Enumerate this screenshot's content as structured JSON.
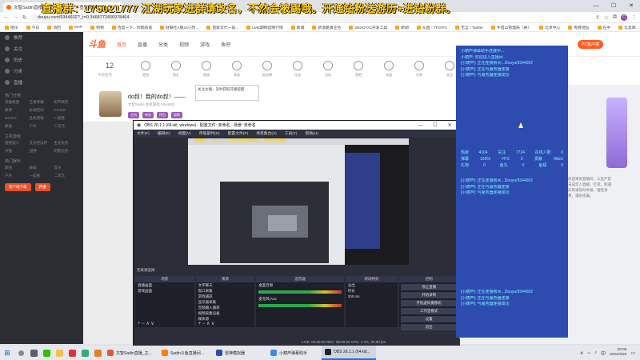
{
  "browser": {
    "tab_title": "文智Sadin直播_主机游戏直播 - 斗鱼直播",
    "url": "douyu.com/9344602?_r=0.3468772456978464",
    "bookmarks": [
      "哈乐",
      "今日",
      "消回",
      "MAP",
      "购物",
      "百度一下，你就知道",
      "财联社A股24小时...",
      "首家云代一站...",
      "LME期铜官网行情",
      "新闻",
      "新浪路演业务",
      "3DDOTA2开发工具",
      "新闻",
      "从盘 - TFGIPC",
      "无言 / Twitter",
      "牛首山管理局（县）",
      "北京中心",
      "免费地址",
      "在中",
      "信息库..."
    ],
    "controls": {
      "minimize": "—",
      "maximize": "☐",
      "close": "✕"
    },
    "profile_initial": "C"
  },
  "banner": "直播群：175021777 江湖玩家进群请改名，不然会被踢哦。开通钻粉送游历+进钻粉群。",
  "sidebar": {
    "items": [
      "推荐",
      "关注",
      "历史",
      "分类",
      "直播"
    ],
    "section1": "热门分类",
    "grid1": [
      "英雄联盟",
      "王者荣耀",
      "和平精英",
      "原神",
      "永劫无间",
      "CS:GO",
      "DOTA2",
      "主机游戏",
      "一起看",
      "颜值",
      "户外",
      "二次元"
    ],
    "section2": "主机游戏",
    "grid2": [
      "怪物猎人",
      "艾尔登法环",
      "生化危机",
      "只狼",
      "战神",
      "刺客信条"
    ],
    "section3": "热门娱乐",
    "grid3": [
      "颜值",
      "舞蹈",
      "音乐",
      "户外",
      "一起看",
      "二次元"
    ],
    "buttons": [
      "客户端下载",
      "开播"
    ]
  },
  "nav": {
    "logo": "斗鱼",
    "items": [
      "首页",
      "直播",
      "分类",
      "视频",
      "游戏",
      "鱼吧"
    ],
    "pc": "PC客户端"
  },
  "category_row": {
    "count": "12",
    "count_label": "今日任务",
    "icons": [
      "签到",
      "鱼丸",
      "鱼翅",
      "贵族",
      "粉丝牌",
      "任务",
      "活动",
      "鱼吧",
      "充值",
      "分享",
      "关注",
      "上一页",
      "一键领取",
      "更多"
    ]
  },
  "room": {
    "title": "do叔！我的do叔！——",
    "meta": "文智Sadin  主机游戏  9344602",
    "tags": [
      "主机",
      "单机",
      "怀旧",
      "剧情"
    ],
    "popup": "关注主播，及时获取开播提醒"
  },
  "right_text": "欢迎来到直播间，斗鱼严禁未成年人直播、打赏。如遇异常请及时举报。理性消费，谨防诈骗。",
  "obs": {
    "title": "OBS 26.1.1 (64-bit, windows) - 配置文件: 未命名 - 场景: 未命名",
    "menu": [
      "文件(F)",
      "编辑(E)",
      "视图(V)",
      "停靠部件(D)",
      "配置文件(P)",
      "场景集合(S)",
      "工具(T)",
      "帮助(H)"
    ],
    "preview_banner": "直播群：175021777 江湖玩家进群请改名，不然会被踢哦",
    "toolbar": "无来源选择",
    "panels": {
      "scenes": {
        "title": "场景",
        "items": [
          "直播画面",
          "游戏画面"
        ]
      },
      "sources": {
        "title": "来源",
        "items": [
          "文字聊天",
          "窗口采集",
          "游戏捕获",
          "显示器采集",
          "音频输入捕获",
          "视频采集设备",
          "媒体源"
        ]
      },
      "mixer": {
        "title": "混音器",
        "items": [
          "桌面音频",
          "麦克风/Aux"
        ]
      },
      "transitions": {
        "title": "转场特效",
        "type": "淡出",
        "duration_label": "时长",
        "duration": "300 ms"
      },
      "controls": {
        "title": "控制",
        "buttons": [
          "停止直播",
          "开始录制",
          "开始虚拟摄像机",
          "工作室模式",
          "设置",
          "退出"
        ]
      }
    },
    "status": "LIVE: 00:00:00   REC: 00:00:00   CPU: 1.4%, 30.00 fps",
    "add_buttons": "+ − ∧ ∨"
  },
  "chat": {
    "lines_top": [
      "小葫芦弹幕助手连接中...",
      "小葫芦: 欢迎进入直播间",
      "[小葫芦]: 正在连接房间...Douyu/9344602",
      "[小葫芦]: 正在与服务器连接",
      "[小葫芦]: 与服务器连接成功"
    ],
    "stats": [
      [
        "热度",
        "4164",
        "关注",
        "7724",
        "在线人数",
        "0"
      ],
      [
        "弹幕",
        "180%",
        "FPS",
        "0",
        "贡献",
        "0kb/s"
      ],
      [
        "礼物",
        "0",
        "鱼丸",
        "0",
        "鱼翅",
        "0"
      ]
    ],
    "lines_mid": [
      "[小葫芦]: 正在连接房间...Douyu/9344602",
      "[小葫芦]: 正在与服务器连接",
      "[小葫芦]: 与服务器连接成功"
    ],
    "lines_bot": [
      "[小葫芦]: 正在连接房间...Douyu/9344602",
      "[小葫芦]: 正在与服务器连接",
      "[小葫芦]: 与服务器连接成功"
    ]
  },
  "taskbar": {
    "start": "⊞",
    "apps": [
      "文智Sadin直播_主...",
      "Sadin斗鱼直播间...",
      "雷神模拟器",
      "小葫芦弹幕助手",
      "OBS 26.1.1 (64-bit..."
    ],
    "clock_time": "20:00",
    "clock_date": "2022/3/20",
    "lang": "中"
  },
  "colors": {
    "brand": "#ff5d23",
    "chat_bg": "#2e4bb0",
    "chat_text": "#7cf0ff",
    "banner": "#ffd21f"
  }
}
